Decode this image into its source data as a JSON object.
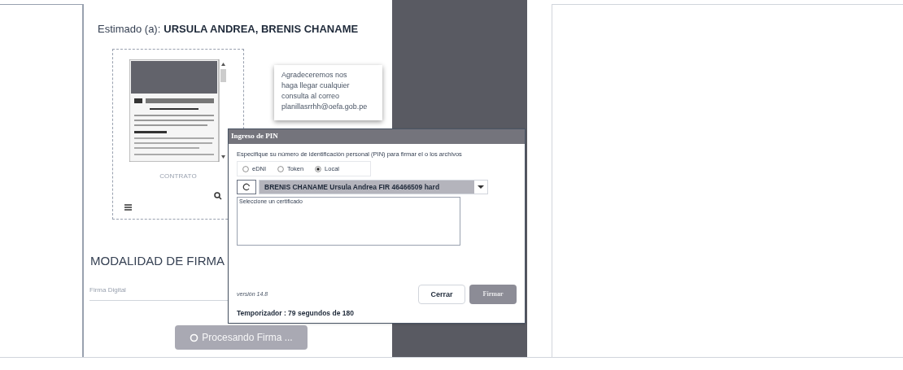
{
  "greeting": {
    "label": "Estimado (a):",
    "name": "URSULA ANDREA, BRENIS CHANAME"
  },
  "document_card": {
    "caption": "CONTRATO"
  },
  "tooltip": {
    "lines": [
      "Agradeceremos nos",
      "haga llegar cualquier",
      "consulta al correo",
      "planillasrrhh@oefa.gob.pe"
    ]
  },
  "section_title": "MODALIDAD DE FIRMA",
  "signature_mode": {
    "value": "Firma Digital"
  },
  "process_button": {
    "label": "Procesando Firma ...",
    "disabled": true
  },
  "dialog": {
    "title": "Ingreso de PIN",
    "instruction": "Especifique su número de identificación personal (PIN) para firmar el o los archivos",
    "options": [
      {
        "label": "eDNI",
        "selected": false
      },
      {
        "label": "Token",
        "selected": false
      },
      {
        "label": "Local",
        "selected": true
      }
    ],
    "certificate": "BRENIS CHANAME Ursula Andrea FIR 46466509 hard",
    "message": "Seleccione un certificado",
    "version": "versión 14.8",
    "buttons": [
      {
        "label": "Cerrar",
        "disabled": false
      },
      {
        "label": "Firmar",
        "disabled": true
      }
    ],
    "timer": "Temporizador : 79 segundos de 180"
  }
}
